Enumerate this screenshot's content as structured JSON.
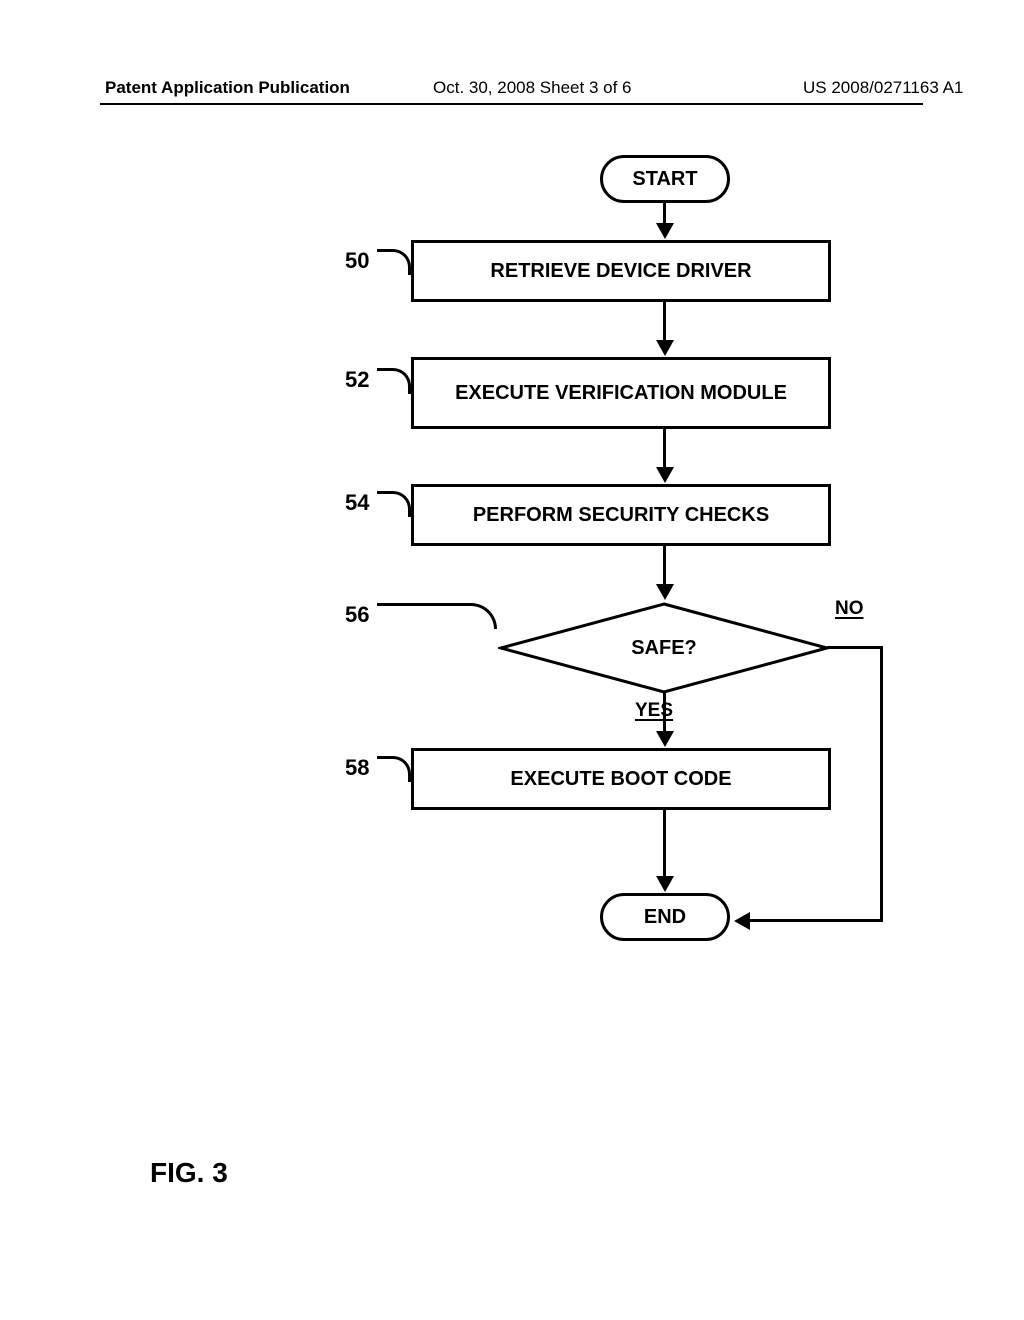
{
  "header": {
    "left": "Patent Application Publication",
    "mid": "Oct. 30, 2008  Sheet 3 of 6",
    "right": "US 2008/0271163 A1"
  },
  "refs": {
    "r50": "50",
    "r52": "52",
    "r54": "54",
    "r56": "56",
    "r58": "58"
  },
  "boxes": {
    "start": "START",
    "b50": "RETRIEVE DEVICE DRIVER",
    "b52": "EXECUTE VERIFICATION MODULE",
    "b54": "PERFORM SECURITY CHECKS",
    "b56": "SAFE?",
    "b58": "EXECUTE BOOT CODE",
    "end": "END"
  },
  "edges": {
    "yes": "YES",
    "no": "NO"
  },
  "figure": "FIG. 3"
}
